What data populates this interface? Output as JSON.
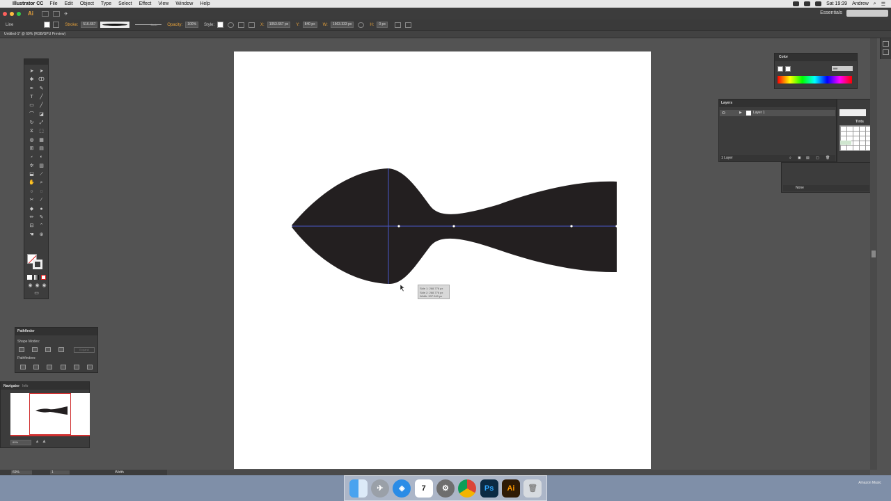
{
  "menubar": {
    "app_name": "Illustrator CC",
    "items": [
      "File",
      "Edit",
      "Object",
      "Type",
      "Select",
      "Effect",
      "View",
      "Window",
      "Help"
    ],
    "clock": "Sat 19:39",
    "user": "Andrew"
  },
  "appbar": {
    "logo": "Ai",
    "workspace": "Essentials"
  },
  "controlbar": {
    "tool": "Line",
    "stroke_label": "Stroke:",
    "stroke_value": "516.667",
    "profile_basic": "Basic",
    "opacity_label": "Opacity:",
    "opacity_value": "100%",
    "style_label": "Style:",
    "x_label": "X:",
    "x_value": "1053.667 px",
    "y_label": "Y:",
    "y_value": "840 px",
    "w_label": "W:",
    "w_value": "1563.333 px",
    "h_label": "H:",
    "h_value": "0 px"
  },
  "document": {
    "tab_title": "Untitled-1* @ 69% (RGB/GPU Preview)"
  },
  "measure_tooltip": {
    "line1": "Side 1: 268.776 px",
    "line2": "Side 2: 268.776 px",
    "line3": "Width: 537.549 px"
  },
  "pathfinder": {
    "title": "Pathfinder",
    "shape_modes": "Shape Modes:",
    "pathfinders": "Pathfinders:",
    "expand": "Expand"
  },
  "navigator": {
    "tab1": "Navigator",
    "tab2": "Info",
    "zoom": "69%"
  },
  "color_panel": {
    "title": "Color",
    "hex": "ffffff"
  },
  "layers_panel": {
    "title": "Layers",
    "layer_name": "Layer 1",
    "count": "1 Layer"
  },
  "swatch_panel": {
    "tints": "Tints"
  },
  "behind_panel": {
    "none": "None"
  },
  "statusbar": {
    "zoom": "69%",
    "page": "1",
    "tool_label": "Width"
  },
  "dock": {
    "items": [
      "finder-icon",
      "launchpad-icon",
      "safari-icon",
      "calendar-icon",
      "system-preferences-icon",
      "chrome-icon",
      "photoshop-icon",
      "illustrator-icon",
      "trash-icon"
    ],
    "calendar_day": "7",
    "ps": "Ps",
    "ai": "Ai",
    "now_playing": "Amazon Music"
  },
  "colors": {
    "accent": "#e8a33a",
    "shape": "#231f20",
    "guide": "#4a57c7"
  }
}
